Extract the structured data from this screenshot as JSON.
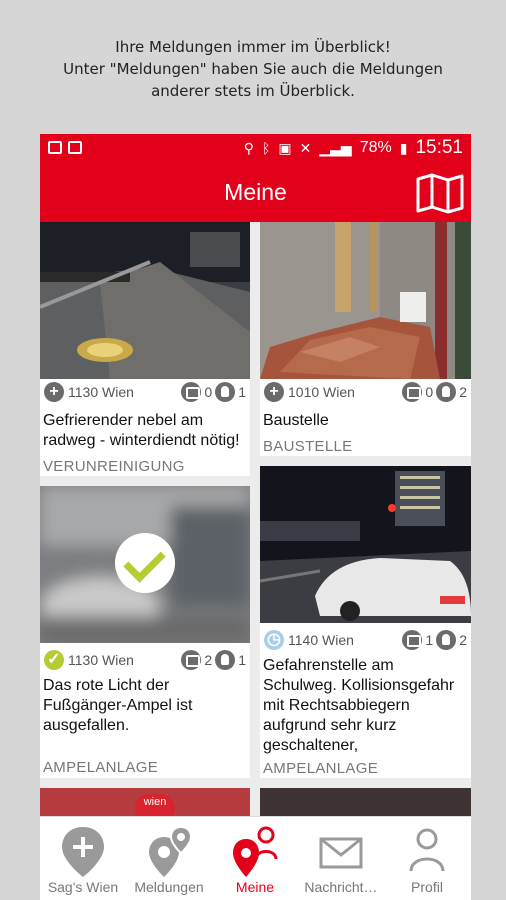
{
  "caption": {
    "line1": "Ihre Meldungen immer im Überblick!",
    "line2": "Unter \"Meldungen\" haben Sie auch die Meldungen",
    "line3": "anderer stets im Überblick."
  },
  "statusbar": {
    "battery": "78%",
    "time": "15:51"
  },
  "appbar": {
    "title": "Meine"
  },
  "cards": [
    {
      "address": "1130 Wien",
      "comments": "0",
      "likes": "1",
      "title": "Gefrierender nebel am radweg - winterdiendt nötig!",
      "category": "VERUNREINIGUNG",
      "status_icon": "plus-icon"
    },
    {
      "address": "1010 Wien",
      "comments": "0",
      "likes": "2",
      "title": "Baustelle",
      "category": "BAUSTELLE",
      "status_icon": "plus-icon"
    },
    {
      "address": "1130 Wien",
      "comments": "2",
      "likes": "1",
      "title": "Das rote Licht der Fußgänger-Ampel ist ausgefallen.",
      "category": "AMPELANLAGE",
      "status_icon": "check-icon"
    },
    {
      "address": "1140 Wien",
      "comments": "1",
      "likes": "2",
      "title": "Gefahrenstelle am Schulweg. Kollisionsgefahr mit Rechtsabbiegern aufgrund sehr kurz geschaltener,",
      "category": "AMPELANLAGE",
      "status_icon": "clock-icon"
    }
  ],
  "peek_text": "wien",
  "nav": [
    {
      "label": "Sag's Wien"
    },
    {
      "label": "Meldungen"
    },
    {
      "label": "Meine"
    },
    {
      "label": "Nachricht…"
    },
    {
      "label": "Profil"
    }
  ],
  "colors": {
    "brand_red": "#e2001a",
    "status_green": "#b7cc32",
    "status_blue": "#a9cfe8"
  }
}
